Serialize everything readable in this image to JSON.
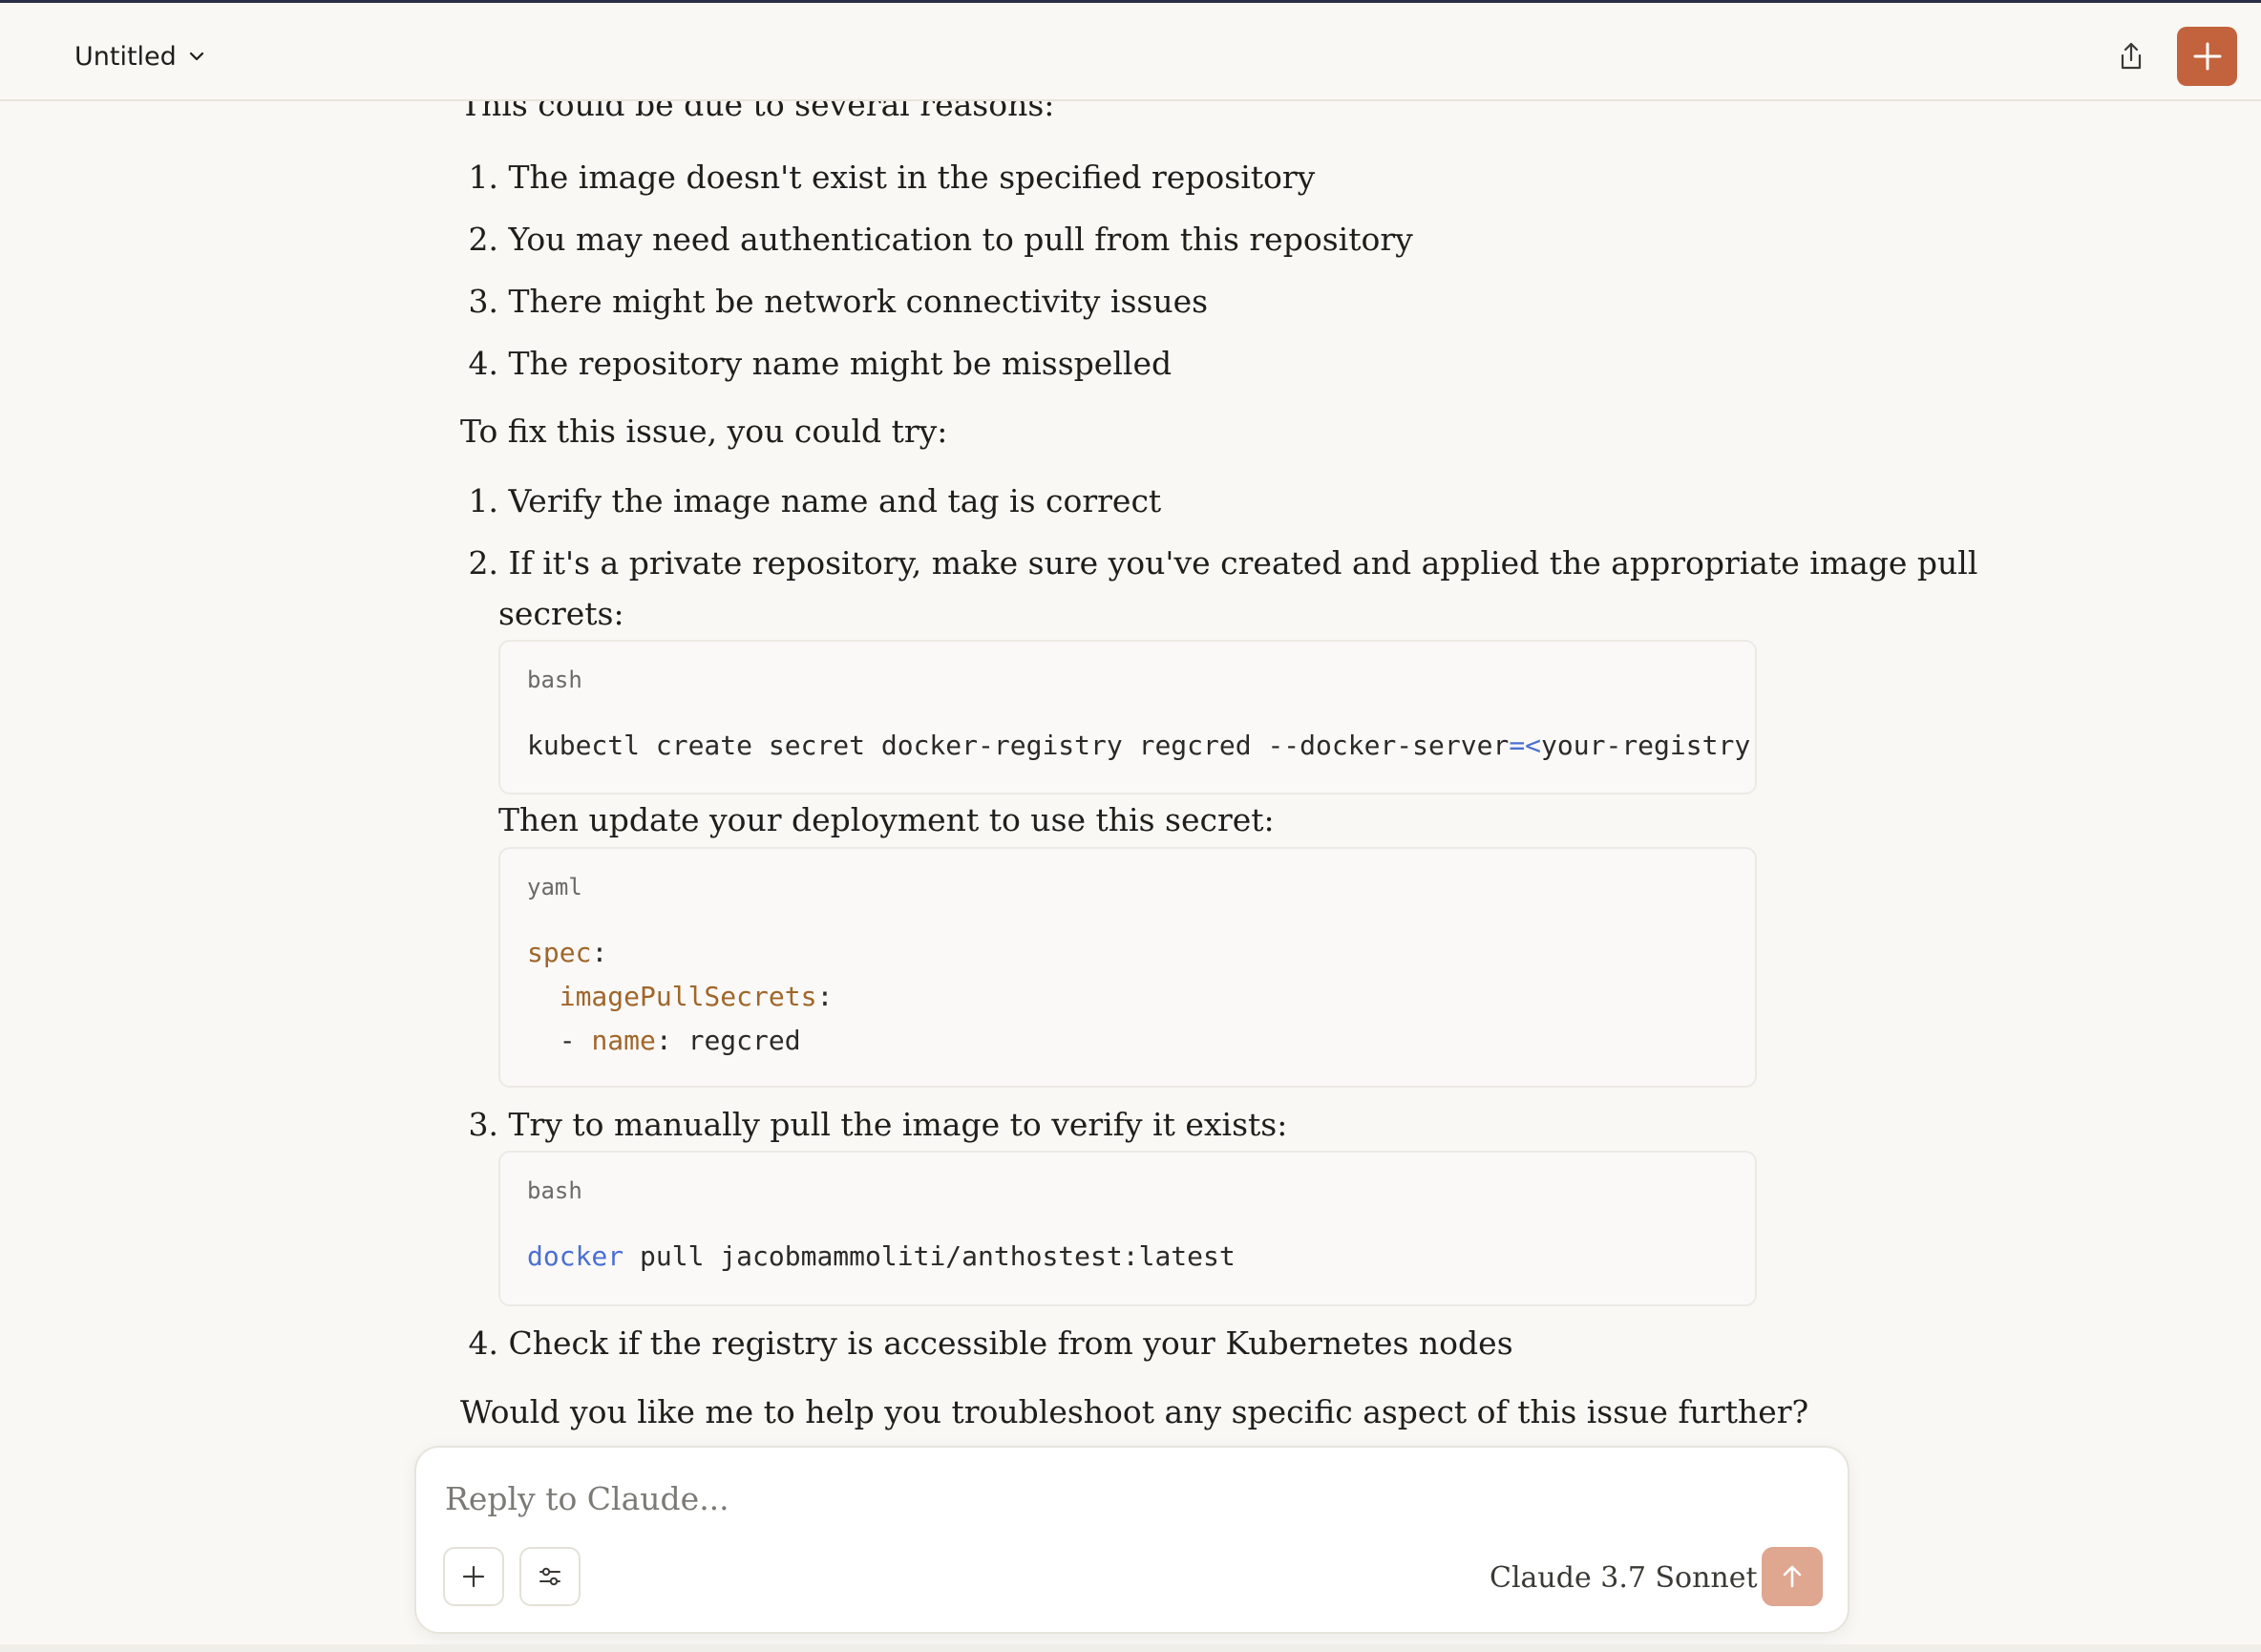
{
  "header": {
    "title": "Untitled"
  },
  "message": {
    "intro": "This could be due to several reasons:",
    "reasons": [
      {
        "num": "1.",
        "text": "The image doesn't exist in the specified repository"
      },
      {
        "num": "2.",
        "text": "You may need authentication to pull from this repository"
      },
      {
        "num": "3.",
        "text": "There might be network connectivity issues"
      },
      {
        "num": "4.",
        "text": "The repository name might be misspelled"
      }
    ],
    "fix_intro": "To fix this issue, you could try:",
    "fix1": {
      "num": "1.",
      "text": "Verify the image name and tag is correct"
    },
    "fix2": {
      "num": "2.",
      "text": "If it's a private repository, make sure you've created and applied the appropriate image pull",
      "text_cont": "secrets:"
    },
    "code1": {
      "lang": "bash",
      "cmd": "kubectl create secret docker-registry regcred --docker-server",
      "op": "=<",
      "rest": "your-registry-se"
    },
    "then_update": "Then update your deployment to use this secret:",
    "code2": {
      "lang": "yaml",
      "k1": "spec",
      "k2": "imagePullSecrets",
      "dash": "- ",
      "k3": "name",
      "v3": "regcred"
    },
    "fix3": {
      "num": "3.",
      "text": "Try to manually pull the image to verify it exists:"
    },
    "code3": {
      "lang": "bash",
      "cmd": "docker",
      "rest": " pull jacobmammoliti/anthostest:latest"
    },
    "fix4": {
      "num": "4.",
      "text": "Check if the registry is accessible from your Kubernetes nodes"
    },
    "closing": "Would you like me to help you troubleshoot any specific aspect of this issue further?"
  },
  "composer": {
    "placeholder": "Reply to Claude...",
    "model": "Claude 3.7 Sonnet"
  },
  "icons": {
    "title_dropdown": "chevron-down-icon",
    "share": "share-icon",
    "new_chat": "plus-icon",
    "attach": "plus-icon",
    "tools": "sliders-icon",
    "model_dropdown": "chevron-down-icon",
    "send": "arrow-up-icon"
  },
  "colors": {
    "accent": "#c2633d",
    "send_disabled": "#dfa690",
    "code_key": "#a0662a",
    "code_blue": "#4a6fd3"
  }
}
